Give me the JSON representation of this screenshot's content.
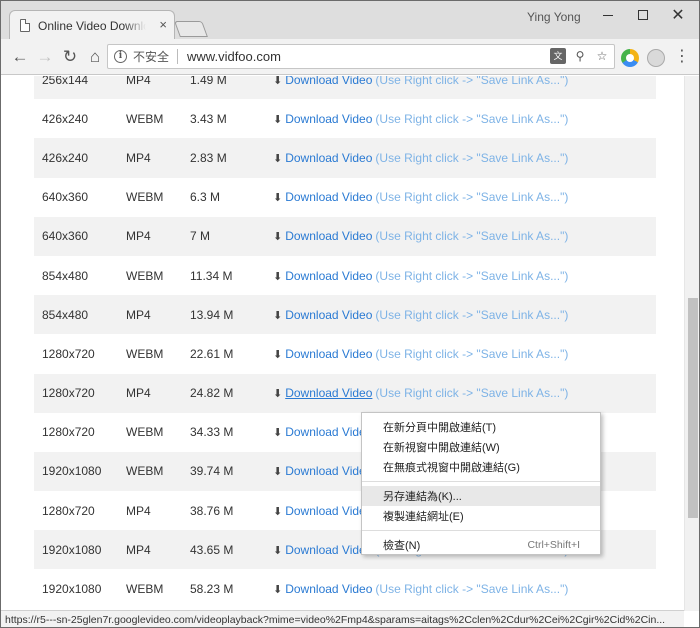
{
  "window": {
    "user": "Ying Yong",
    "minimize": "minimize",
    "maximize": "maximize",
    "close": "✕"
  },
  "tab": {
    "title": "Online Video Downloader",
    "close": "×"
  },
  "toolbar": {
    "back": "←",
    "forward": "→",
    "reload": "↻",
    "home": "⌂",
    "security_label": "不安全",
    "url": "www.vidfoo.com",
    "menu": "⋮"
  },
  "icons": {
    "info": "i",
    "translate": "文",
    "zoom": "⚲",
    "star": "☆",
    "download": "⬇"
  },
  "table": {
    "link_label": "Download Video",
    "hint": "(Use Right click -> \"Save Link As...\")",
    "rows": [
      {
        "resolution": "256x144",
        "format": "MP4",
        "size": "1.49 M"
      },
      {
        "resolution": "426x240",
        "format": "WEBM",
        "size": "3.43 M"
      },
      {
        "resolution": "426x240",
        "format": "MP4",
        "size": "2.83 M"
      },
      {
        "resolution": "640x360",
        "format": "WEBM",
        "size": "6.3 M"
      },
      {
        "resolution": "640x360",
        "format": "MP4",
        "size": "7 M"
      },
      {
        "resolution": "854x480",
        "format": "WEBM",
        "size": "11.34 M"
      },
      {
        "resolution": "854x480",
        "format": "MP4",
        "size": "13.94 M"
      },
      {
        "resolution": "1280x720",
        "format": "WEBM",
        "size": "22.61 M"
      },
      {
        "resolution": "1280x720",
        "format": "MP4",
        "size": "24.82 M"
      },
      {
        "resolution": "1280x720",
        "format": "WEBM",
        "size": "34.33 M"
      },
      {
        "resolution": "1920x1080",
        "format": "WEBM",
        "size": "39.74 M"
      },
      {
        "resolution": "1280x720",
        "format": "MP4",
        "size": "38.76 M"
      },
      {
        "resolution": "1920x1080",
        "format": "MP4",
        "size": "43.65 M"
      },
      {
        "resolution": "1920x1080",
        "format": "WEBM",
        "size": "58.23 M"
      }
    ]
  },
  "status_url": "https://r5---sn-25glen7r.googlevideo.com/videoplayback?mime=video%2Fmp4&sparams=aitags%2Cclen%2Cdur%2Cei%2Cgir%2Cid%2Cin...",
  "context_menu": {
    "items": [
      {
        "label": "在新分頁中開啟連結(T)"
      },
      {
        "label": "在新視窗中開啟連結(W)"
      },
      {
        "label": "在無痕式視窗中開啟連結(G)"
      },
      {
        "label": "另存連結為(K)..."
      },
      {
        "label": "複製連結網址(E)"
      },
      {
        "label": "檢查(N)",
        "shortcut": "Ctrl+Shift+I"
      }
    ]
  }
}
